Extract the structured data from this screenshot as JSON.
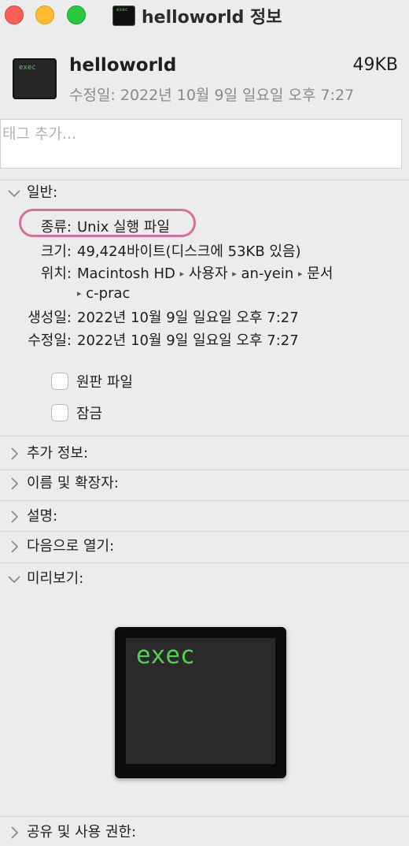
{
  "window": {
    "title": "helloworld 정보",
    "traffic_lights": {
      "close_color": "#fd5f57",
      "minimize_color": "#febc2e",
      "maximize_color": "#28c840"
    }
  },
  "header": {
    "file_name": "helloworld",
    "file_size": "49KB",
    "modified": "수정일: 2022년 10월 9일 일요일 오후 7:27",
    "icon_text": "exec"
  },
  "tags": {
    "placeholder": "태그 추가..."
  },
  "general": {
    "label": "일반:",
    "rows": {
      "kind": {
        "label": "종류:",
        "value": "Unix 실행 파일"
      },
      "size": {
        "label": "크기:",
        "value": "49,424바이트(디스크에 53KB 있음)"
      },
      "where": {
        "label": "위치:",
        "path": [
          "Macintosh HD",
          "사용자",
          "an-yein",
          "문서",
          "c-prac"
        ]
      },
      "created": {
        "label": "생성일:",
        "value": "2022년 10월 9일 일요일 오후 7:27"
      },
      "modified": {
        "label": "수정일:",
        "value": "2022년 10월 9일 일요일 오후 7:27"
      }
    },
    "stationery_label": "원판 파일",
    "locked_label": "잠금"
  },
  "sections": {
    "more_info": "추가 정보:",
    "name_extension": "이름 및 확장자:",
    "comments": "설명:",
    "open_with": "다음으로 열기:",
    "preview": "미리보기:",
    "sharing": "공유 및 사용 권한:"
  },
  "preview": {
    "text": "exec"
  },
  "colors": {
    "terminal_green": "#52d152",
    "highlight_ring": "#d6709b"
  },
  "icons": {
    "collapsed": "chevron-right-icon",
    "expanded": "chevron-down-icon",
    "path_separator": "▸"
  }
}
